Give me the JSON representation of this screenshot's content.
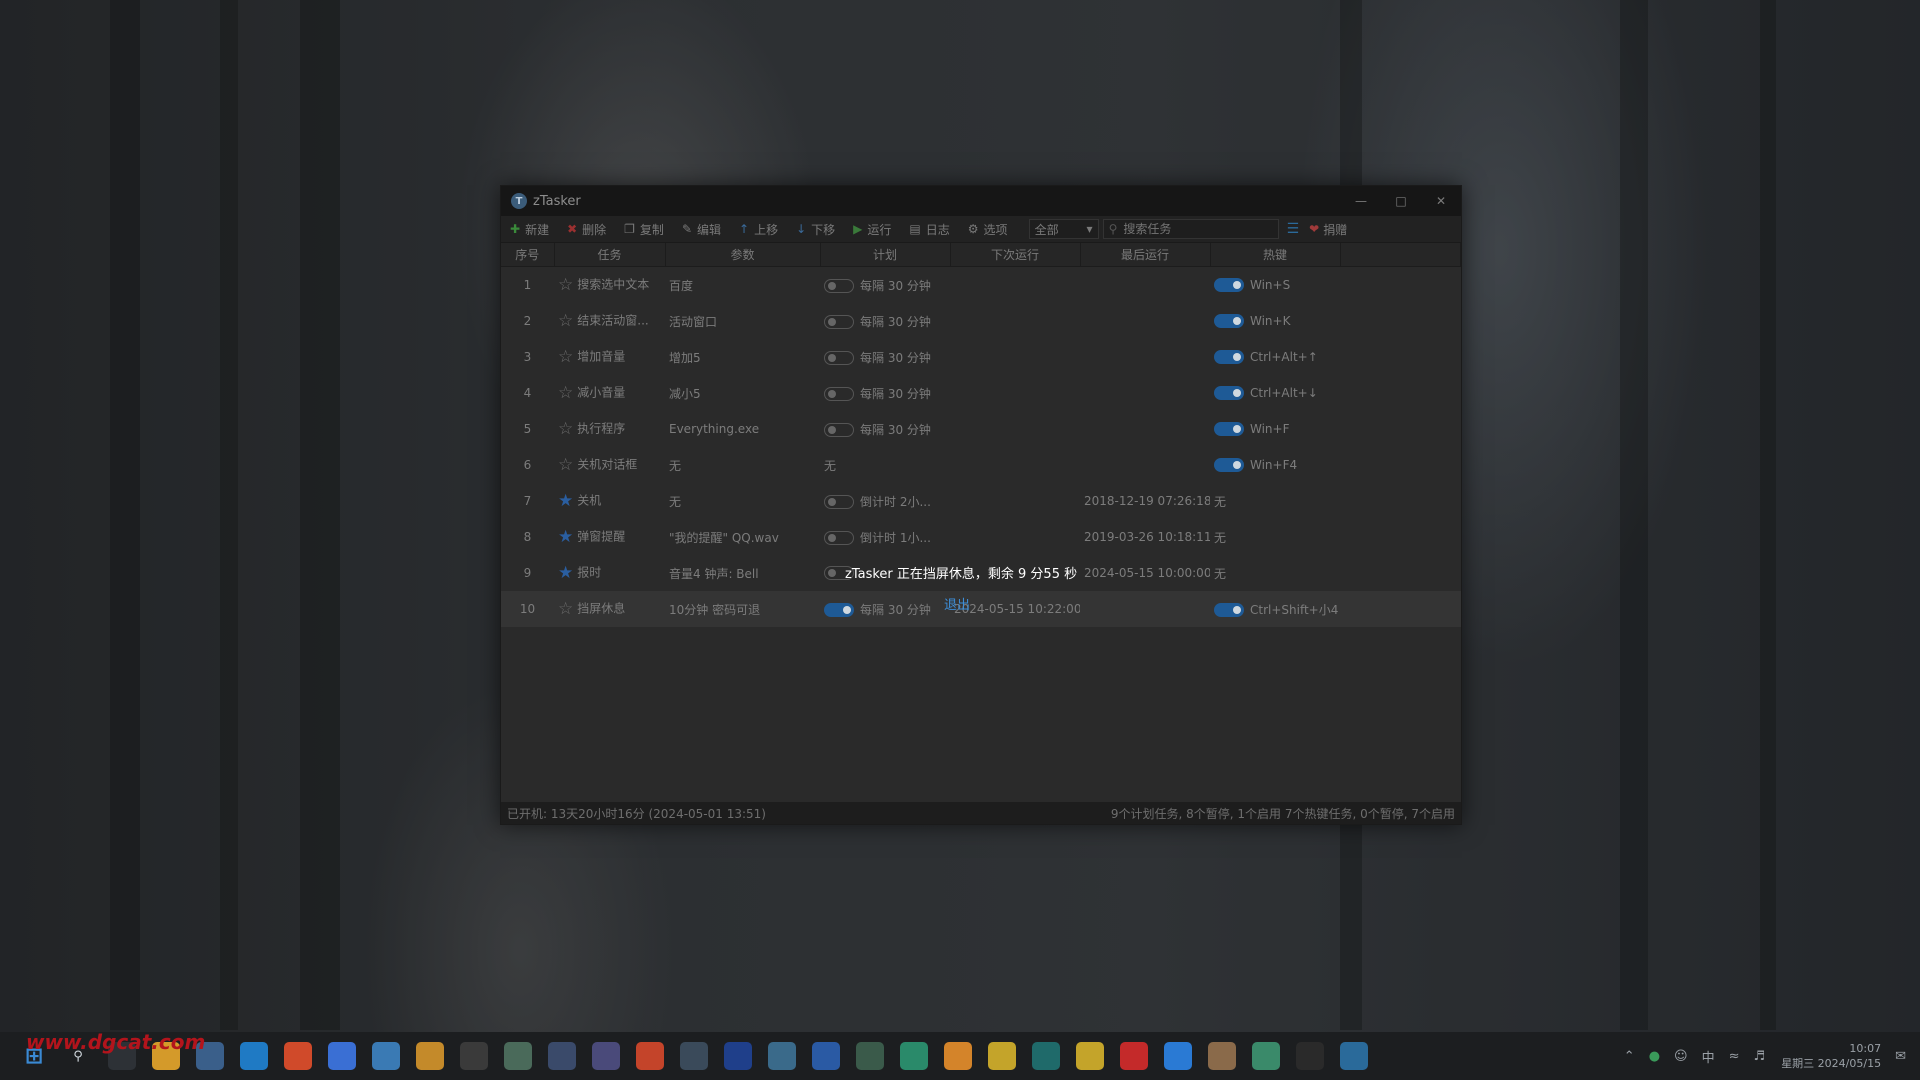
{
  "window": {
    "title": "zTasker"
  },
  "toolbar": {
    "new": "新建",
    "delete": "删除",
    "copy": "复制",
    "edit": "编辑",
    "move_up": "上移",
    "move_down": "下移",
    "run": "运行",
    "log": "日志",
    "options": "选项",
    "filter_value": "全部",
    "search_placeholder": "搜索任务",
    "donate": "捐赠"
  },
  "columns": {
    "index": "序号",
    "task": "任务",
    "params": "参数",
    "schedule": "计划",
    "next_run": "下次运行",
    "last_run": "最后运行",
    "hotkey": "热键"
  },
  "tasks": [
    {
      "index": "1",
      "star": false,
      "name": "搜索选中文本",
      "params": "百度",
      "toggle": "off",
      "schedule": "每隔 30 分钟",
      "next_run": "",
      "last_run": "",
      "hotkey_toggle": "on",
      "hotkey": "Win+S"
    },
    {
      "index": "2",
      "star": false,
      "name": "结束活动窗...",
      "params": "活动窗口",
      "toggle": "off",
      "schedule": "每隔 30 分钟",
      "next_run": "",
      "last_run": "",
      "hotkey_toggle": "on",
      "hotkey": "Win+K"
    },
    {
      "index": "3",
      "star": false,
      "name": "增加音量",
      "params": "增加5",
      "toggle": "off",
      "schedule": "每隔 30 分钟",
      "next_run": "",
      "last_run": "",
      "hotkey_toggle": "on",
      "hotkey": "Ctrl+Alt+↑"
    },
    {
      "index": "4",
      "star": false,
      "name": "减小音量",
      "params": "减小5",
      "toggle": "off",
      "schedule": "每隔 30 分钟",
      "next_run": "",
      "last_run": "",
      "hotkey_toggle": "on",
      "hotkey": "Ctrl+Alt+↓"
    },
    {
      "index": "5",
      "star": false,
      "name": "执行程序",
      "params": "Everything.exe",
      "toggle": "off",
      "schedule": "每隔 30 分钟",
      "next_run": "",
      "last_run": "",
      "hotkey_toggle": "on",
      "hotkey": "Win+F"
    },
    {
      "index": "6",
      "star": false,
      "name": "关机对话框",
      "params": "无",
      "toggle": "none",
      "schedule": "无",
      "next_run": "",
      "last_run": "",
      "hotkey_toggle": "on",
      "hotkey": "Win+F4"
    },
    {
      "index": "7",
      "star": true,
      "name": "关机",
      "params": "无",
      "toggle": "off",
      "schedule": "倒计时 2小...",
      "next_run": "",
      "last_run": "2018-12-19 07:26:18",
      "hotkey_toggle": "none",
      "hotkey": "无"
    },
    {
      "index": "8",
      "star": true,
      "name": "弹窗提醒",
      "params": "\"我的提醒\" QQ.wav",
      "toggle": "off",
      "schedule": "倒计时 1小...",
      "next_run": "",
      "last_run": "2019-03-26 10:18:11",
      "hotkey_toggle": "none",
      "hotkey": "无"
    },
    {
      "index": "9",
      "star": true,
      "name": "报时",
      "params": "音量4 钟声: Bell",
      "toggle": "off",
      "schedule": "",
      "next_run": "",
      "last_run": "2024-05-15 10:00:00",
      "hotkey_toggle": "none",
      "hotkey": "无"
    },
    {
      "index": "10",
      "star": false,
      "name": "挡屏休息",
      "params": "10分钟 密码可退",
      "toggle": "on",
      "schedule": "每隔 30 分钟",
      "next_run": "2024-05-15 10:22:00",
      "last_run": "",
      "hotkey_toggle": "on",
      "hotkey": "Ctrl+Shift+小4"
    }
  ],
  "status": {
    "uptime": "已开机: 13天20小时16分 (2024-05-01 13:51)",
    "summary": "9个计划任务, 8个暂停, 1个启用    7个热键任务, 0个暂停, 7个启用"
  },
  "overlay": {
    "message": "zTasker 正在挡屏休息，剩余 9 分55 秒",
    "exit": "退出"
  },
  "watermark": "www.dgcat.com",
  "taskbar": {
    "apps": [
      "start-icon",
      "search-icon",
      "terminal-icon",
      "files-icon",
      "notepad-icon",
      "edge-icon",
      "chrome-icon",
      "music-icon",
      "vmware-icon",
      "search-tool-icon",
      "bilibili-icon",
      "image-viewer-icon",
      "code-icon",
      "obs-icon",
      "powerpoint-icon",
      "remote-desktop-icon",
      "photoshop-icon",
      "chart-icon",
      "calendar-icon",
      "network-icon",
      "cloud-icon",
      "folder-app-icon",
      "chat-icon",
      "x-app-icon",
      "tool-icon",
      "wps-icon",
      "check-app-icon",
      "settings-app-icon",
      "monitor-icon",
      "qq-icon",
      "ztasker-icon"
    ],
    "tray_ime": "中",
    "time": "10:07",
    "date": "星期三 2024/05/15"
  }
}
